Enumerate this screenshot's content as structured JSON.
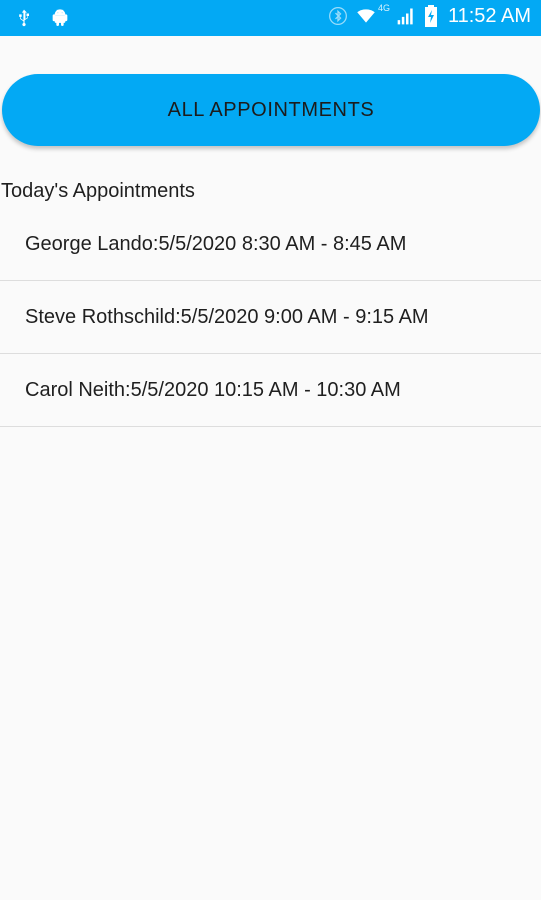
{
  "status_bar": {
    "icons_left": [
      "usb-icon",
      "android-icon"
    ],
    "icons_right": [
      "bluetooth-icon",
      "wifi-icon",
      "signal-icon",
      "battery-icon"
    ],
    "network_type": "4G",
    "time": "11:52 AM",
    "color": "#03a9f4"
  },
  "main": {
    "all_appointments_label": "ALL APPOINTMENTS",
    "section_title": "Today's Appointments",
    "appointments": [
      {
        "text": "George Lando:5/5/2020 8:30 AM - 8:45 AM"
      },
      {
        "text": "Steve Rothschild:5/5/2020 9:00 AM - 9:15 AM"
      },
      {
        "text": "Carol Neith:5/5/2020 10:15 AM - 10:30 AM"
      }
    ]
  }
}
